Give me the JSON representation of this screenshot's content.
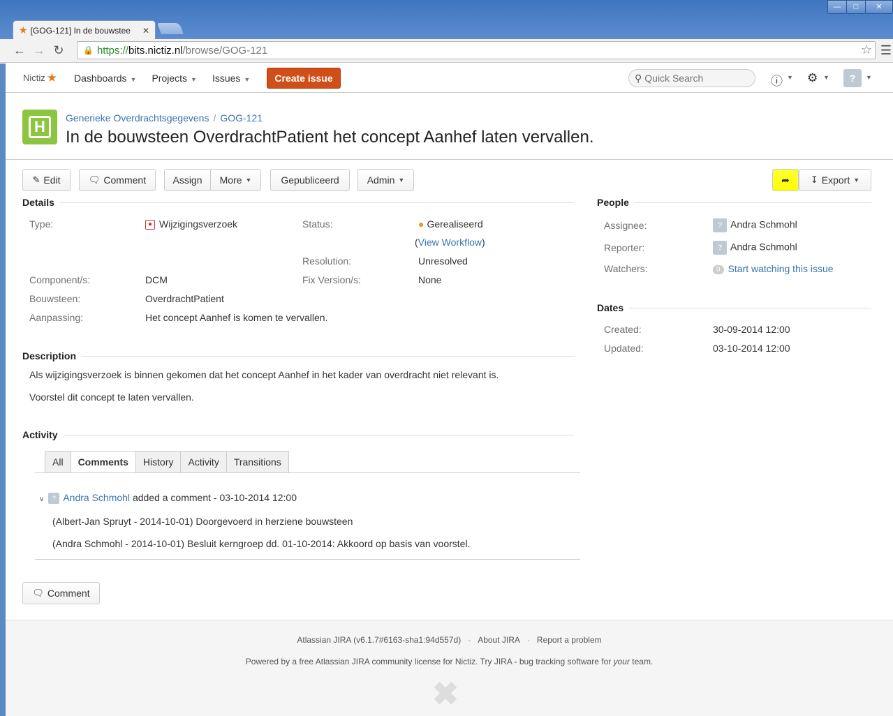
{
  "browser": {
    "tab_title": "[GOG-121] In de bouwstee",
    "url_scheme": "https://",
    "url_host": "bits.nictiz.nl",
    "url_path": "/browse/GOG-121"
  },
  "header": {
    "logo": "Nictiz",
    "nav": [
      "Dashboards",
      "Projects",
      "Issues"
    ],
    "create_label": "Create issue",
    "search_placeholder": "Quick Search"
  },
  "issue": {
    "project": "Generieke Overdrachtsgegevens",
    "key": "GOG-121",
    "summary": "In de bouwsteen OverdrachtPatient het concept Aanhef laten vervallen.",
    "project_avatar_letter": "H"
  },
  "ops": {
    "edit": "Edit",
    "comment": "Comment",
    "assign": "Assign",
    "more": "More",
    "gepubliceerd": "Gepubliceerd",
    "admin": "Admin",
    "export": "Export"
  },
  "details": {
    "heading": "Details",
    "type_label": "Type:",
    "type_value": "Wijzigingsverzoek",
    "status_label": "Status:",
    "status_value": "Gerealiseerd",
    "view_workflow": "View Workflow",
    "resolution_label": "Resolution:",
    "resolution_value": "Unresolved",
    "component_label": "Component/s:",
    "component_value": "DCM",
    "fixversion_label": "Fix Version/s:",
    "fixversion_value": "None",
    "bouwsteen_label": "Bouwsteen:",
    "bouwsteen_value": "OverdrachtPatient",
    "aanpassing_label": "Aanpassing:",
    "aanpassing_value": "Het concept Aanhef is komen te vervallen."
  },
  "description": {
    "heading": "Description",
    "p1": "Als wijzigingsverzoek is binnen gekomen dat het concept Aanhef in het kader van overdracht niet relevant is.",
    "p2": "Voorstel dit concept te laten vervallen."
  },
  "activity": {
    "heading": "Activity",
    "tabs": [
      "All",
      "Comments",
      "History",
      "Activity",
      "Transitions"
    ],
    "comment_author": "Andra Schmohl",
    "comment_meta": "added a comment - 03-10-2014 12:00",
    "comment_line1": "(Albert-Jan Spruyt - 2014-10-01) Doorgevoerd in herziene bouwsteen",
    "comment_line2": "(Andra Schmohl - 2014-10-01) Besluit kerngroep dd. 01-10-2014: Akkoord op basis van voorstel.",
    "comment_button": "Comment"
  },
  "people": {
    "heading": "People",
    "assignee_label": "Assignee:",
    "assignee_value": "Andra Schmohl",
    "reporter_label": "Reporter:",
    "reporter_value": "Andra Schmohl",
    "watchers_label": "Watchers:",
    "watchers_count": "0",
    "watch_link": "Start watching this issue"
  },
  "dates": {
    "heading": "Dates",
    "created_label": "Created:",
    "created_value": "30-09-2014 12:00",
    "updated_label": "Updated:",
    "updated_value": "03-10-2014 12:00"
  },
  "footer": {
    "version": "Atlassian JIRA (v6.1.7#6163-sha1:94d557d)",
    "about": "About JIRA",
    "report": "Report a problem",
    "powered_pre": "Powered by a free Atlassian JIRA community license for Nictiz. Try JIRA - bug tracking software for ",
    "powered_em": "your",
    "powered_post": " team."
  },
  "colors": {
    "accent_link": "#3b73af",
    "create_button": "#d04e17",
    "project_avatar": "#8cc63f"
  }
}
